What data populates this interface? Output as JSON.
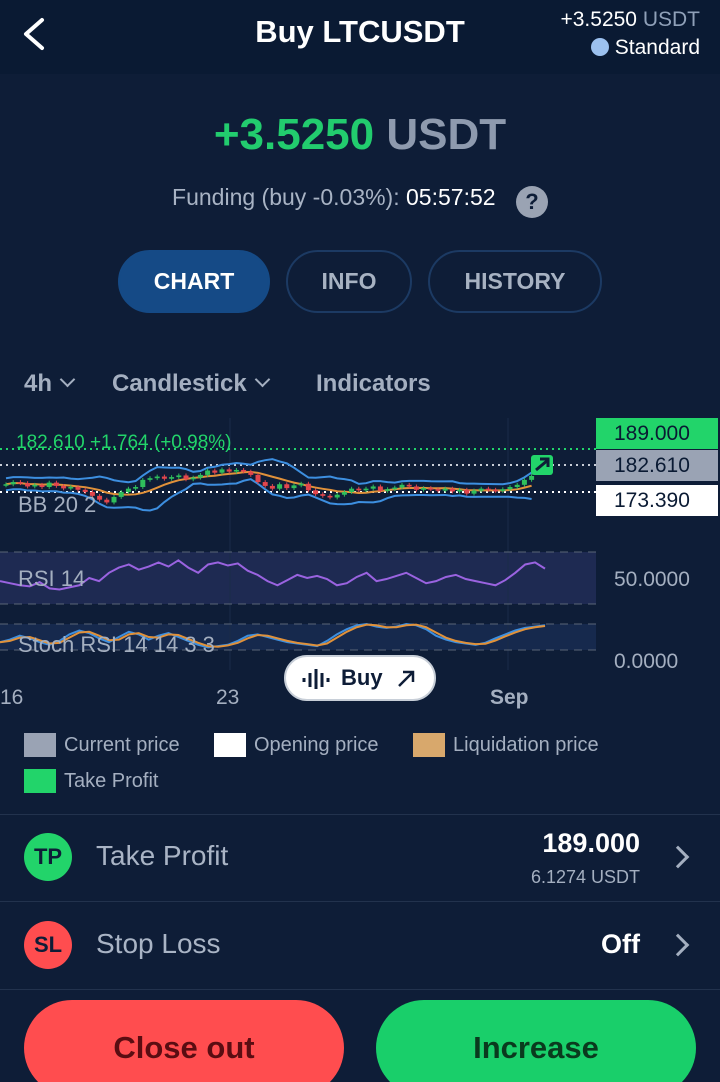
{
  "header": {
    "title": "Buy LTCUSDT",
    "pnl": "+3.5250",
    "pnl_unit": "USDT",
    "mode": "Standard"
  },
  "summary": {
    "pnl": "+3.5250",
    "unit": "USDT",
    "funding_label": "Funding (buy -0.03%):",
    "funding_countdown": "05:57:52",
    "help_glyph": "?"
  },
  "tabs": [
    {
      "label": "CHART",
      "active": true
    },
    {
      "label": "INFO",
      "active": false
    },
    {
      "label": "HISTORY",
      "active": false
    }
  ],
  "controls": {
    "interval": "4h",
    "chart_type": "Candlestick",
    "indicators": "Indicators"
  },
  "chart_data": {
    "type": "candlestick",
    "annotation": "182.610  +1.764 (+0.98%)",
    "price_labels": {
      "take_profit": "189.000",
      "current": "182.610",
      "opening": "173.390"
    },
    "indicator_labels": {
      "bb": "BB 20 2",
      "rsi": "RSI 14",
      "stoch": "Stoch RSI 14 14 3 3"
    },
    "rsi_axis": [
      "50.0000",
      "0.0000"
    ],
    "x_ticks": [
      {
        "label": "16",
        "bold": false
      },
      {
        "label": "23",
        "bold": false
      },
      {
        "label": "Sep",
        "bold": true
      }
    ],
    "close": [
      176.2,
      177.0,
      176.6,
      175.4,
      176.0,
      175.2,
      176.8,
      175.6,
      174.7,
      175.2,
      174.2,
      173.4,
      172.0,
      170.6,
      169.6,
      171.6,
      173.4,
      174.6,
      175.2,
      177.8,
      178.4,
      179.0,
      178.2,
      178.8,
      179.4,
      178.0,
      178.6,
      179.6,
      181.2,
      180.4,
      181.6,
      180.8,
      181.4,
      180.8,
      179.6,
      177.0,
      175.6,
      174.6,
      176.2,
      174.8,
      175.8,
      176.4,
      174.0,
      172.6,
      172.0,
      171.4,
      172.4,
      173.4,
      174.6,
      174.0,
      174.6,
      175.4,
      173.8,
      174.4,
      175.0,
      176.0,
      175.4,
      174.2,
      174.8,
      174.4,
      173.9,
      174.6,
      173.6,
      174.2,
      172.8,
      173.9,
      174.6,
      174.2,
      173.8,
      174.4,
      175.2,
      176.0,
      177.8,
      179.2
    ],
    "rsi": [
      52,
      50,
      48,
      47,
      51,
      45,
      44,
      46,
      48,
      55,
      52,
      60,
      65,
      68,
      63,
      66,
      70,
      66,
      72,
      65,
      60,
      68,
      70,
      67,
      69,
      62,
      58,
      52,
      48,
      53,
      58,
      55,
      57,
      54,
      48,
      50,
      56,
      60,
      52,
      54,
      57,
      60,
      55,
      50,
      52,
      56,
      58,
      54,
      52,
      50,
      48,
      53,
      60,
      68,
      70,
      64
    ],
    "stoch": [
      30,
      40,
      55,
      45,
      30,
      20,
      35,
      60,
      75,
      65,
      45,
      30,
      50,
      70,
      60,
      40,
      55,
      65,
      50,
      35,
      20,
      10,
      15,
      20,
      35,
      55,
      60,
      50,
      40,
      30,
      25,
      20,
      15,
      35,
      60,
      80,
      95,
      100,
      90,
      85,
      90,
      100,
      95,
      80,
      55,
      40,
      30,
      25,
      20,
      28,
      45,
      60,
      75,
      85,
      90,
      95
    ]
  },
  "legend": [
    {
      "label": "Current price",
      "color": "#9aa3b4"
    },
    {
      "label": "Opening price",
      "color": "#ffffff"
    },
    {
      "label": "Liquidation price",
      "color": "#d8a86c"
    },
    {
      "label": "Take Profit",
      "color": "#22d46a"
    }
  ],
  "buy_pill": {
    "label": "Buy"
  },
  "take_profit": {
    "badge": "TP",
    "label": "Take Profit",
    "value": "189.000",
    "sub": "6.1274 USDT"
  },
  "stop_loss": {
    "badge": "SL",
    "label": "Stop Loss",
    "value": "Off"
  },
  "actions": {
    "close": "Close out",
    "increase": "Increase"
  }
}
